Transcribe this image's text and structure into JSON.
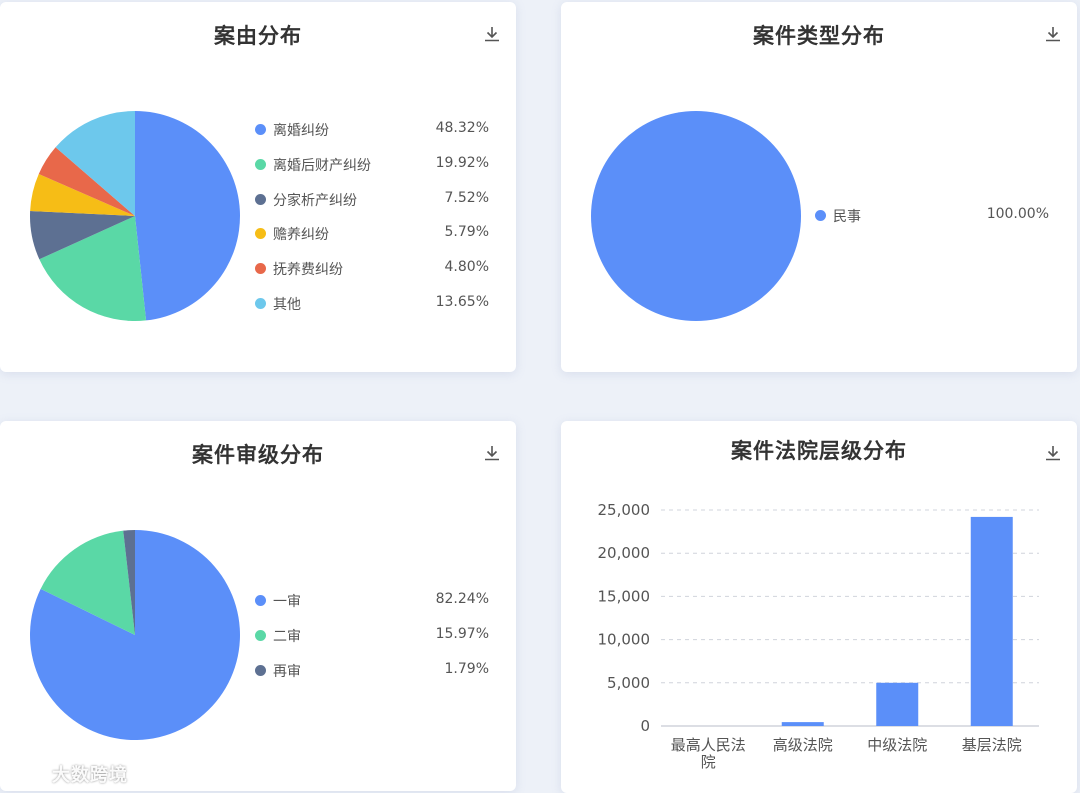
{
  "cards": [
    {
      "title": "案由分布"
    },
    {
      "title": "案件类型分布"
    },
    {
      "title": "案件审级分布"
    },
    {
      "title": "案件法院层级分布"
    }
  ],
  "watermark": "大数跨境",
  "chart_data": [
    {
      "type": "pie",
      "title": "案由分布",
      "labels": [
        "离婚纠纷",
        "离婚后财产纠纷",
        "分家析产纠纷",
        "赡养纠纷",
        "抚养费纠纷",
        "其他"
      ],
      "values": [
        48.32,
        19.92,
        7.52,
        5.79,
        4.8,
        13.65
      ],
      "value_labels": [
        "48.32%",
        "19.92%",
        "7.52%",
        "5.79%",
        "4.80%",
        "13.65%"
      ],
      "colors": [
        "#5b8ff9",
        "#5ad8a6",
        "#5d7092",
        "#f6bd16",
        "#e8684a",
        "#6dc8ec"
      ],
      "legend": "right"
    },
    {
      "type": "pie",
      "title": "案件类型分布",
      "labels": [
        "民事"
      ],
      "values": [
        100.0
      ],
      "value_labels": [
        "100.00%"
      ],
      "colors": [
        "#5b8ff9"
      ],
      "legend": "right"
    },
    {
      "type": "pie",
      "title": "案件审级分布",
      "labels": [
        "一审",
        "二审",
        "再审"
      ],
      "values": [
        82.24,
        15.97,
        1.79
      ],
      "value_labels": [
        "82.24%",
        "15.97%",
        "1.79%"
      ],
      "colors": [
        "#5b8ff9",
        "#5ad8a6",
        "#5d7092"
      ],
      "legend": "right"
    },
    {
      "type": "bar",
      "title": "案件法院层级分布",
      "categories": [
        "最高人民法院",
        "高级法院",
        "中级法院",
        "基层法院"
      ],
      "values": [
        0,
        450,
        5000,
        24200
      ],
      "ylim": [
        0,
        25000
      ],
      "yticks": [
        0,
        5000,
        10000,
        15000,
        20000,
        25000
      ],
      "ytick_labels": [
        "0",
        "5,000",
        "10,000",
        "15,000",
        "20,000",
        "25,000"
      ],
      "color": "#5b8ff9",
      "grid": true
    }
  ]
}
